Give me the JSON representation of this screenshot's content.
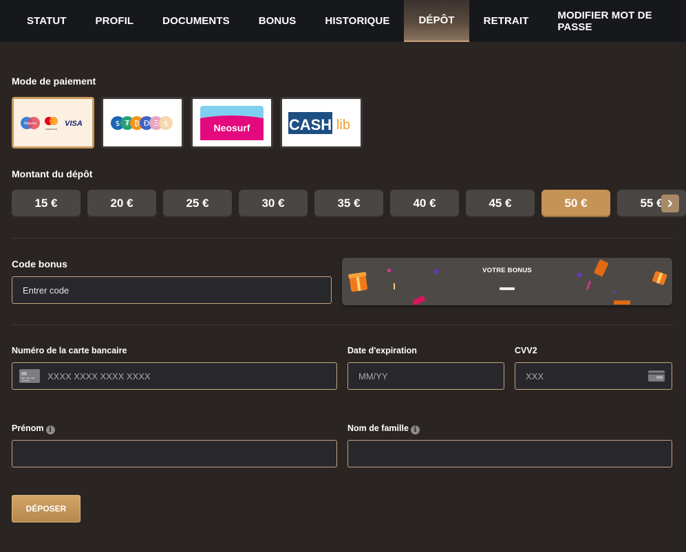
{
  "nav": {
    "tabs": [
      {
        "label": "STATUT"
      },
      {
        "label": "PROFIL"
      },
      {
        "label": "DOCUMENTS"
      },
      {
        "label": "BONUS"
      },
      {
        "label": "HISTORIQUE"
      },
      {
        "label": "DÉPÔT",
        "active": true
      },
      {
        "label": "RETRAIT"
      },
      {
        "label": "MODIFIER MOT DE PASSE"
      }
    ]
  },
  "payment": {
    "label": "Mode de paiement",
    "methods": [
      {
        "name": "cards",
        "texts": [
          "Maestro",
          "mastercard",
          "VISA"
        ],
        "selected": true
      },
      {
        "name": "crypto",
        "texts": [
          "$",
          "₮",
          "₿",
          "Ð",
          "Ξ",
          "$"
        ]
      },
      {
        "name": "neosurf",
        "texts": [
          "Neosurf"
        ]
      },
      {
        "name": "cashlib",
        "texts": [
          "CASH",
          "lib"
        ]
      }
    ]
  },
  "amount": {
    "label": "Montant du dépôt",
    "options": [
      "15 €",
      "20 €",
      "25 €",
      "30 €",
      "35 €",
      "40 €",
      "45 €",
      "50 €",
      "55 €"
    ],
    "selected": "50 €"
  },
  "bonus": {
    "label": "Code bonus",
    "placeholder": "Entrer code",
    "banner_title": "VOTRE BONUS"
  },
  "card": {
    "number_label": "Numéro de la carte bancaire",
    "number_placeholder": "XXXX XXXX XXXX XXXX",
    "expiry_label": "Date d'expiration",
    "expiry_placeholder": "MM/YY",
    "cvv_label": "CVV2",
    "cvv_placeholder": "XXX"
  },
  "name": {
    "first_label": "Prénom",
    "last_label": "Nom de famille"
  },
  "submit_label": "DÉPOSER",
  "colors": {
    "background": "#2a2522",
    "nav_background": "#17181c",
    "accent": "#c69356",
    "field_border": "#c6a47e"
  }
}
